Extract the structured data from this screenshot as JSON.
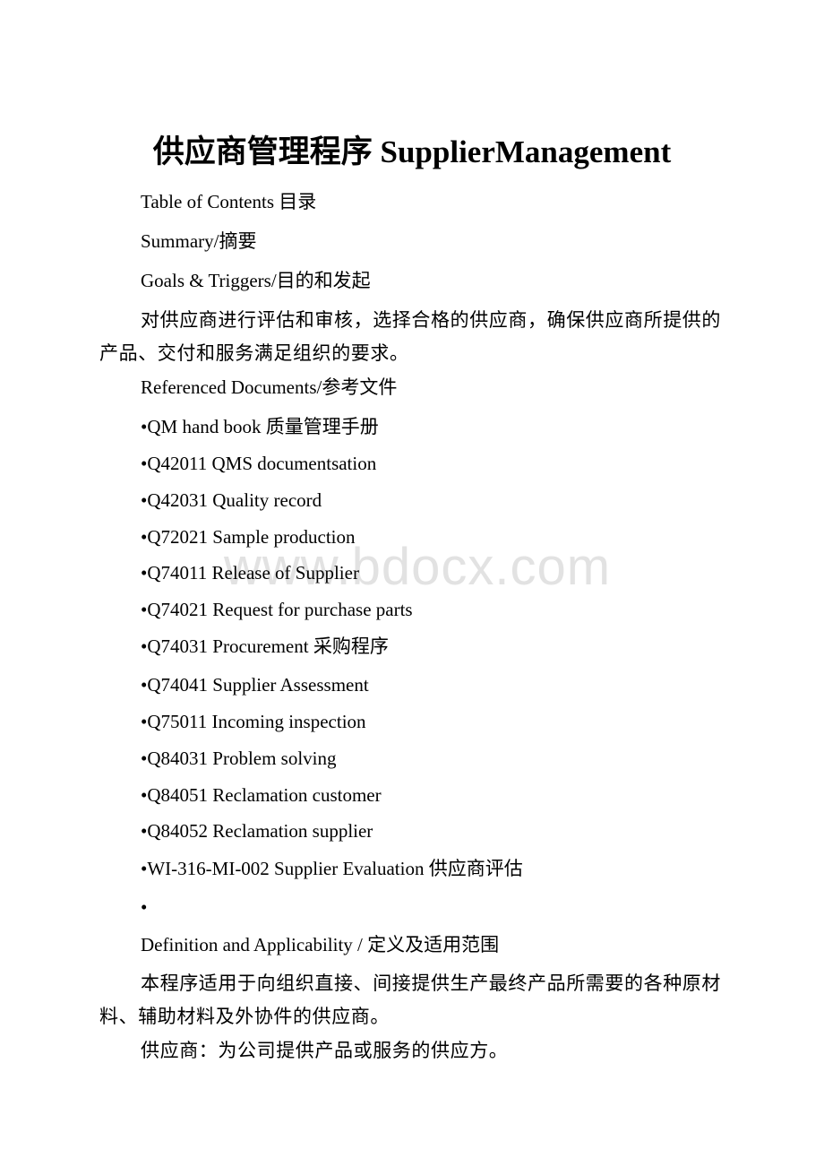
{
  "document": {
    "title": "供应商管理程序 SupplierManagement",
    "toc_heading": "Table of Contents 目录",
    "summary_heading": "Summary/摘要",
    "goals_heading": "Goals & Triggers/目的和发起",
    "goals_text": "对供应商进行评估和审核，选择合格的供应商，确保供应商所提供的产品、交付和服务满足组织的要求。",
    "references_heading": "Referenced Documents/参考文件",
    "references": [
      "•QM hand book 质量管理手册",
      "•Q42011 QMS documentsation",
      "•Q42031 Quality record",
      "•Q72021 Sample production",
      "•Q74011 Release of Supplier",
      "•Q74021 Request for purchase parts",
      "•Q74031 Procurement 采购程序",
      "•Q74041 Supplier Assessment",
      "•Q75011 Incoming inspection",
      "•Q84031 Problem solving",
      "•Q84051 Reclamation customer",
      "•Q84052 Reclamation supplier",
      "•WI-316-MI-002 Supplier Evaluation 供应商评估",
      "•"
    ],
    "definition_heading": "Definition and Applicability / 定义及适用范围",
    "definition_text": "本程序适用于向组织直接、间接提供生产最终产品所需要的各种原材料、辅助材料及外协件的供应商。",
    "supplier_definition": "供应商：为公司提供产品或服务的供应方。"
  },
  "watermark": "www.bdocx.com"
}
